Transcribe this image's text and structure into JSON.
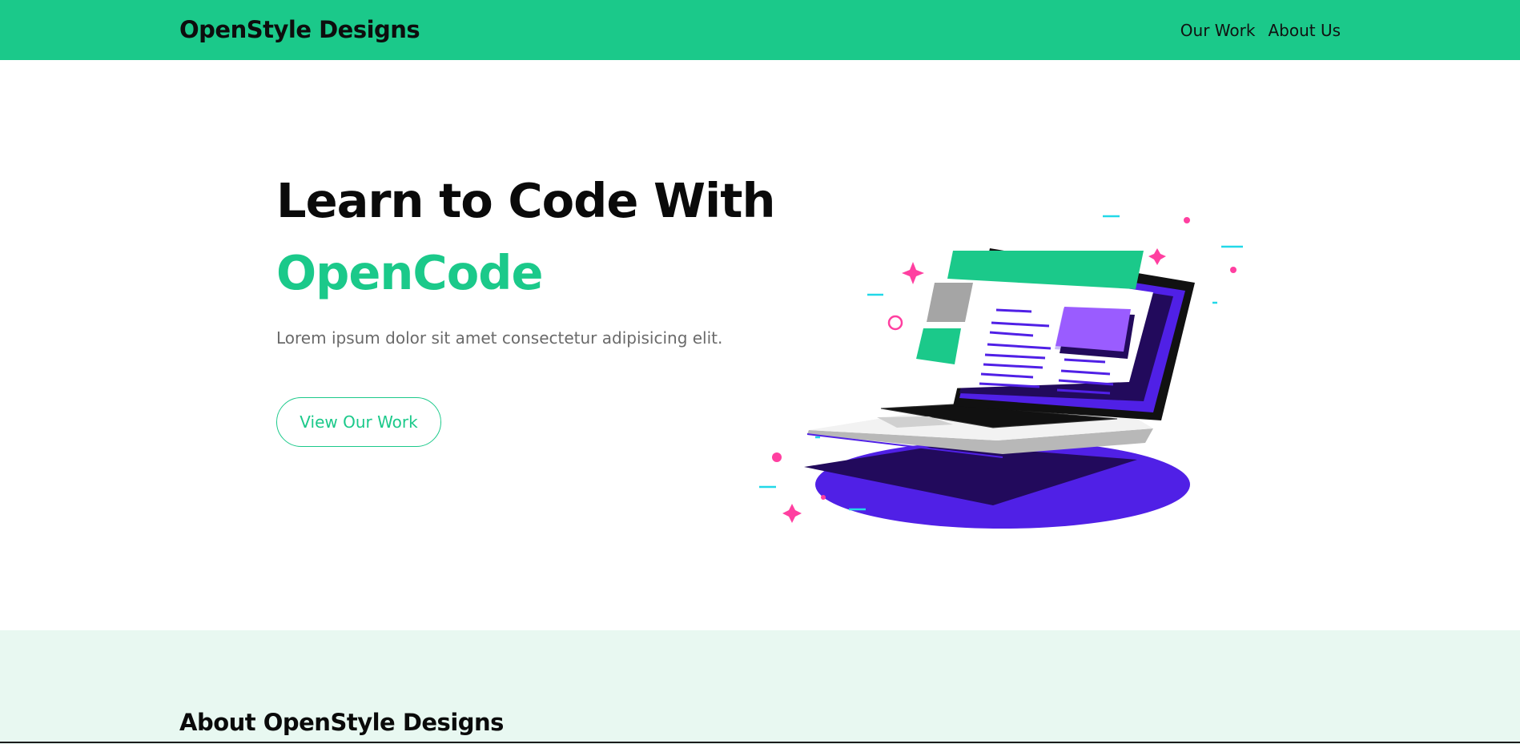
{
  "header": {
    "brand": "OpenStyle Designs",
    "nav": [
      {
        "label": "Our Work"
      },
      {
        "label": "About Us"
      }
    ]
  },
  "hero": {
    "title_line1": "Learn to Code With",
    "title_accent": "OpenCode",
    "subtitle": "Lorem ipsum dolor sit amet consectetur adipisicing elit.",
    "cta_label": "View Our Work",
    "illustration_icon": "laptop-illustration"
  },
  "about": {
    "title": "About OpenStyle Designs"
  },
  "colors": {
    "accent": "#1bc98a",
    "purple": "#5020e6",
    "dark_purple": "#220a5c",
    "pink": "#ff3fa0",
    "cyan": "#22d8e8",
    "about_bg": "#e8f8f1"
  }
}
